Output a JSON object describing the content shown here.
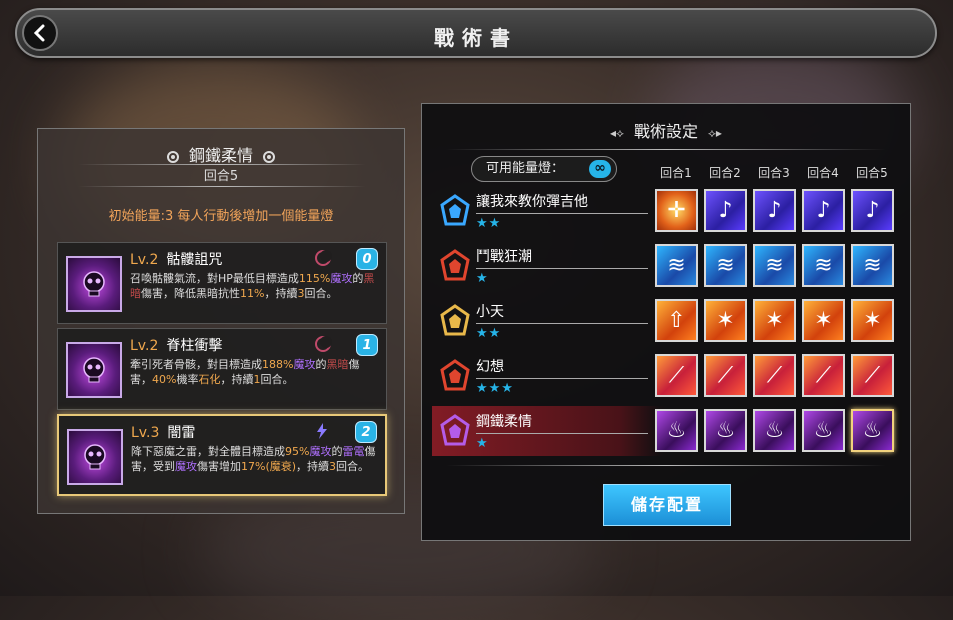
{
  "header": {
    "title": "戰術書"
  },
  "left_panel": {
    "name": "鋼鐵柔情",
    "rounds": "回合5",
    "energy_info": "初始能量:3 每人行動後增加一個能量燈",
    "skills": [
      {
        "level": "Lv.2",
        "name": "骷髏詛咒",
        "icon": "skull-curse-icon",
        "cost": "0",
        "desc": [
          {
            "t": "召喚骷髏氣流，對HP最低目標造成"
          },
          {
            "t": "115%",
            "c": "o"
          },
          {
            "t": "魔攻",
            "c": "p"
          },
          {
            "t": "的"
          },
          {
            "t": "黑暗",
            "c": "r"
          },
          {
            "t": "傷害，降低黑暗抗性"
          },
          {
            "t": "11%",
            "c": "o"
          },
          {
            "t": "，持續"
          },
          {
            "t": "3",
            "c": "o"
          },
          {
            "t": "回合。"
          }
        ]
      },
      {
        "level": "Lv.2",
        "name": "脊柱衝擊",
        "icon": "spine-strike-icon",
        "cost": "1",
        "desc": [
          {
            "t": "牽引死者骨骸，對目標造成"
          },
          {
            "t": "188%",
            "c": "o"
          },
          {
            "t": "魔攻",
            "c": "p"
          },
          {
            "t": "的"
          },
          {
            "t": "黑暗",
            "c": "r"
          },
          {
            "t": "傷害，"
          },
          {
            "t": "40%",
            "c": "o"
          },
          {
            "t": "機率"
          },
          {
            "t": "石化",
            "c": "o"
          },
          {
            "t": "，持續"
          },
          {
            "t": "1",
            "c": "o"
          },
          {
            "t": "回合。"
          }
        ]
      },
      {
        "level": "Lv.3",
        "name": "闇雷",
        "icon": "dark-thunder-icon",
        "cost": "2",
        "desc": [
          {
            "t": "降下惡魔之雷，對全體目標造成"
          },
          {
            "t": "95%",
            "c": "o"
          },
          {
            "t": "魔攻",
            "c": "p"
          },
          {
            "t": "的"
          },
          {
            "t": "雷電",
            "c": "p"
          },
          {
            "t": "傷害，受到"
          },
          {
            "t": "魔攻",
            "c": "p"
          },
          {
            "t": "傷害增加"
          },
          {
            "t": "17%",
            "c": "o"
          },
          {
            "t": "(魔衰)",
            "c": "o"
          },
          {
            "t": "，持續"
          },
          {
            "t": "3",
            "c": "o"
          },
          {
            "t": "回合。"
          }
        ]
      }
    ]
  },
  "right_panel": {
    "title": "戰術設定",
    "energy_label": "可用能量燈：",
    "energy_value": "∞",
    "round_headers": [
      "回合1",
      "回合2",
      "回合3",
      "回合4",
      "回合5"
    ],
    "characters": [
      {
        "name": "讓我來教你彈吉他",
        "stars": "★★",
        "emblem_color": "#3aa8ff",
        "slots": [
          [
            "slot-gold",
            "target-icon",
            "✛"
          ],
          [
            "slot-blue-purple",
            "music-note-icon",
            "♪"
          ],
          [
            "slot-blue-purple",
            "music-note-icon",
            "♪"
          ],
          [
            "slot-blue-purple",
            "music-note-icon",
            "♪"
          ],
          [
            "slot-blue-purple",
            "music-note-icon",
            "♪"
          ]
        ]
      },
      {
        "name": "鬥戰狂潮",
        "stars": "★",
        "emblem_color": "#e0452e",
        "slots": [
          [
            "slot-blue",
            "wave-icon",
            "≋"
          ],
          [
            "slot-blue",
            "wave-icon",
            "≋"
          ],
          [
            "slot-blue",
            "wave-icon",
            "≋"
          ],
          [
            "slot-blue",
            "wave-icon",
            "≋"
          ],
          [
            "slot-blue",
            "wave-icon",
            "≋"
          ]
        ]
      },
      {
        "name": "小天",
        "stars": "★★",
        "emblem_color": "#e8b84a",
        "slots": [
          [
            "slot-orange",
            "arrow-up-icon",
            "⇧"
          ],
          [
            "slot-orange",
            "flame-icon",
            "✶"
          ],
          [
            "slot-orange",
            "flame-icon",
            "✶"
          ],
          [
            "slot-orange",
            "flame-icon",
            "✶"
          ],
          [
            "slot-orange",
            "flame-icon",
            "✶"
          ]
        ]
      },
      {
        "name": "幻想",
        "stars": "★★★",
        "emblem_color": "#e0452e",
        "slots": [
          [
            "slot-red",
            "claw-icon",
            "⟋"
          ],
          [
            "slot-red",
            "claw-icon",
            "⟋"
          ],
          [
            "slot-red",
            "claw-icon",
            "⟋"
          ],
          [
            "slot-red",
            "claw-icon",
            "⟋"
          ],
          [
            "slot-red",
            "claw-icon",
            "⟋"
          ]
        ]
      },
      {
        "name": "鋼鐵柔情",
        "stars": "★",
        "emblem_color": "#b45ce8",
        "selected": true,
        "slots": [
          [
            "slot-purple",
            "dark-flame-icon",
            "♨"
          ],
          [
            "slot-purple",
            "dark-flame-icon",
            "♨"
          ],
          [
            "slot-purple",
            "dark-flame-icon",
            "♨"
          ],
          [
            "slot-purple",
            "dark-flame-icon",
            "♨"
          ],
          [
            "slot-purple",
            "dark-flame-icon",
            "♨"
          ]
        ]
      }
    ],
    "save_label": "儲存配置"
  },
  "colors": {
    "accent_blue": "#26b4e8",
    "highlight_orange": "#f0a84e",
    "highlight_purple": "#b070ff",
    "select_gold": "#f1d27e"
  }
}
